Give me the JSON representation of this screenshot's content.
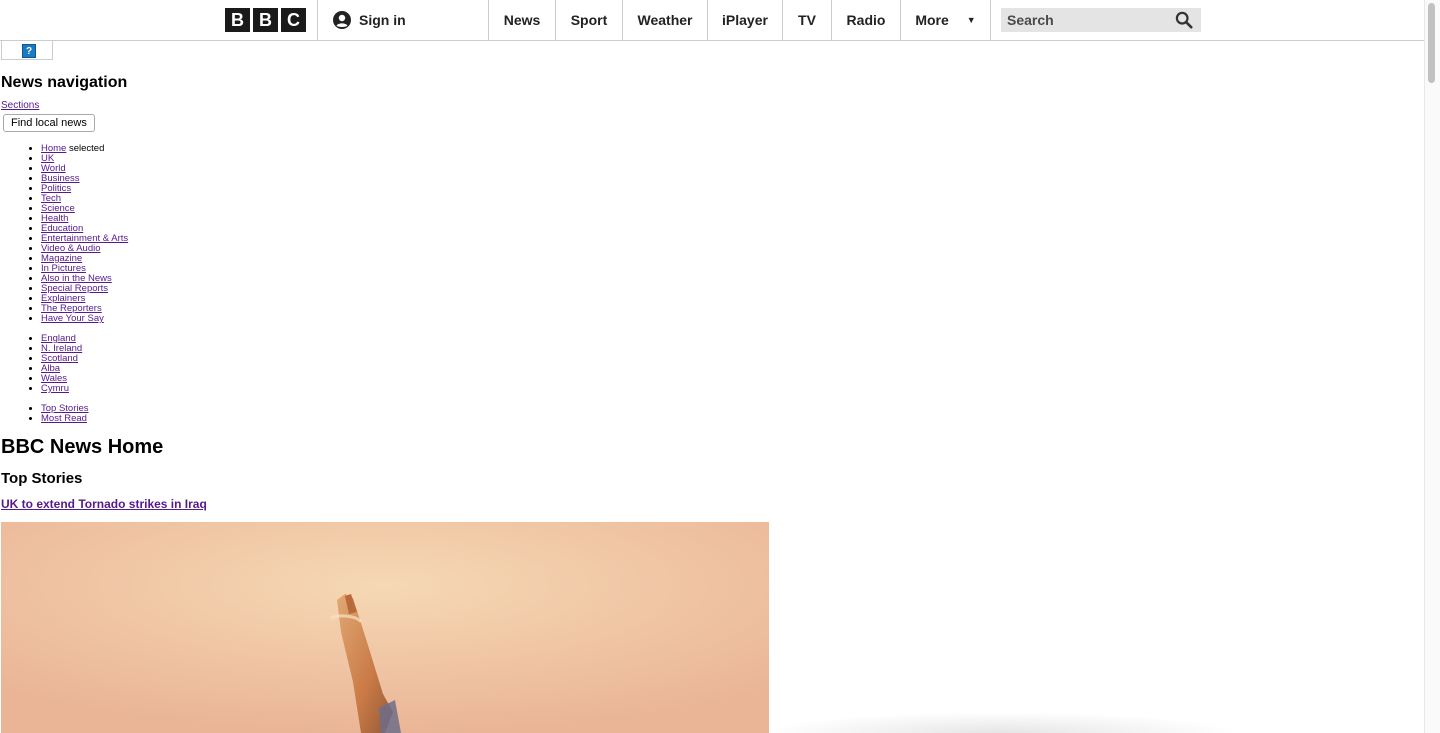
{
  "header": {
    "logo_letters": [
      "B",
      "B",
      "C"
    ],
    "signin_label": "Sign in",
    "nav_items": [
      "News",
      "Sport",
      "Weather",
      "iPlayer",
      "TV",
      "Radio",
      "More"
    ],
    "search_placeholder": "Search"
  },
  "help": {
    "icon_label": "?"
  },
  "news_navigation": {
    "heading": "News navigation",
    "sections_link": "Sections",
    "find_local_button": "Find local news",
    "main_items": [
      {
        "label": "Home",
        "suffix": " selected"
      },
      {
        "label": "UK"
      },
      {
        "label": "World"
      },
      {
        "label": "Business"
      },
      {
        "label": "Politics"
      },
      {
        "label": "Tech"
      },
      {
        "label": "Science"
      },
      {
        "label": "Health"
      },
      {
        "label": "Education"
      },
      {
        "label": "Entertainment & Arts"
      },
      {
        "label": "Video & Audio"
      },
      {
        "label": "Magazine"
      },
      {
        "label": "In Pictures"
      },
      {
        "label": "Also in the News"
      },
      {
        "label": "Special Reports"
      },
      {
        "label": "Explainers"
      },
      {
        "label": "The Reporters"
      },
      {
        "label": "Have Your Say"
      }
    ],
    "region_items": [
      "England",
      "N. Ireland",
      "Scotland",
      "Alba",
      "Wales",
      "Cymru"
    ],
    "extra_items": [
      "Top Stories",
      "Most Read"
    ]
  },
  "main": {
    "page_title": "BBC News Home",
    "section_title": "Top Stories",
    "lead_story_link": "UK to extend Tornado strikes in Iraq"
  },
  "colors": {
    "link_visited": "#551a8b",
    "logo_bg": "#1a1a1a",
    "search_bg": "#e4e4e4",
    "image_sky": "#f4cfa6"
  }
}
